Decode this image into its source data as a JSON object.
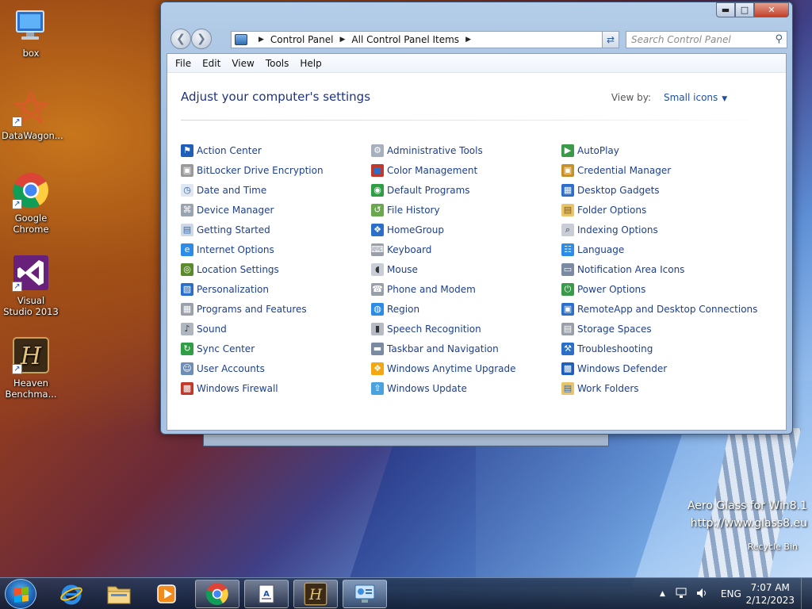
{
  "desktop": {
    "icons": [
      {
        "label": "box"
      },
      {
        "label": "DataWagon..."
      },
      {
        "label": "Google Chrome"
      },
      {
        "label": "Visual Studio 2013"
      },
      {
        "label": "Heaven Benchma..."
      }
    ],
    "watermark": {
      "line1": "Aero Glass for Win8.1",
      "line2": "http://www.glass8.eu",
      "line3": "Recycle Bin"
    }
  },
  "window": {
    "address": {
      "crumb1": "Control Panel",
      "crumb2": "All Control Panel Items"
    },
    "search_placeholder": "Search Control Panel",
    "menu": [
      "File",
      "Edit",
      "View",
      "Tools",
      "Help"
    ],
    "heading": "Adjust your computer's settings",
    "view_by_label": "View by:",
    "view_by_value": "Small icons",
    "columns": [
      [
        {
          "label": "Action Center",
          "icon": "flag-icon"
        },
        {
          "label": "BitLocker Drive Encryption",
          "icon": "bitlocker-icon"
        },
        {
          "label": "Date and Time",
          "icon": "clock-icon"
        },
        {
          "label": "Device Manager",
          "icon": "device-manager-icon"
        },
        {
          "label": "Getting Started",
          "icon": "getting-started-icon"
        },
        {
          "label": "Internet Options",
          "icon": "internet-options-icon"
        },
        {
          "label": "Location Settings",
          "icon": "location-icon"
        },
        {
          "label": "Personalization",
          "icon": "personalization-icon"
        },
        {
          "label": "Programs and Features",
          "icon": "programs-icon"
        },
        {
          "label": "Sound",
          "icon": "sound-icon"
        },
        {
          "label": "Sync Center",
          "icon": "sync-icon"
        },
        {
          "label": "User Accounts",
          "icon": "user-accounts-icon"
        },
        {
          "label": "Windows Firewall",
          "icon": "firewall-icon"
        }
      ],
      [
        {
          "label": "Administrative Tools",
          "icon": "admin-tools-icon"
        },
        {
          "label": "Color Management",
          "icon": "color-management-icon"
        },
        {
          "label": "Default Programs",
          "icon": "default-programs-icon"
        },
        {
          "label": "File History",
          "icon": "file-history-icon"
        },
        {
          "label": "HomeGroup",
          "icon": "homegroup-icon"
        },
        {
          "label": "Keyboard",
          "icon": "keyboard-icon"
        },
        {
          "label": "Mouse",
          "icon": "mouse-icon"
        },
        {
          "label": "Phone and Modem",
          "icon": "phone-modem-icon"
        },
        {
          "label": "Region",
          "icon": "region-icon"
        },
        {
          "label": "Speech Recognition",
          "icon": "microphone-icon"
        },
        {
          "label": "Taskbar and Navigation",
          "icon": "taskbar-icon"
        },
        {
          "label": "Windows Anytime Upgrade",
          "icon": "windows-upgrade-icon"
        },
        {
          "label": "Windows Update",
          "icon": "windows-update-icon"
        }
      ],
      [
        {
          "label": "AutoPlay",
          "icon": "autoplay-icon"
        },
        {
          "label": "Credential Manager",
          "icon": "credential-icon"
        },
        {
          "label": "Desktop Gadgets",
          "icon": "gadgets-icon"
        },
        {
          "label": "Folder Options",
          "icon": "folder-options-icon"
        },
        {
          "label": "Indexing Options",
          "icon": "indexing-icon"
        },
        {
          "label": "Language",
          "icon": "language-icon"
        },
        {
          "label": "Notification Area Icons",
          "icon": "notification-icon"
        },
        {
          "label": "Power Options",
          "icon": "power-icon"
        },
        {
          "label": "RemoteApp and Desktop Connections",
          "icon": "remoteapp-icon"
        },
        {
          "label": "Storage Spaces",
          "icon": "storage-icon"
        },
        {
          "label": "Troubleshooting",
          "icon": "troubleshooting-icon"
        },
        {
          "label": "Windows Defender",
          "icon": "defender-icon"
        },
        {
          "label": "Work Folders",
          "icon": "work-folders-icon"
        }
      ]
    ]
  },
  "taskbar": {
    "language": "ENG",
    "time": "7:07 AM",
    "date": "2/12/2023"
  }
}
